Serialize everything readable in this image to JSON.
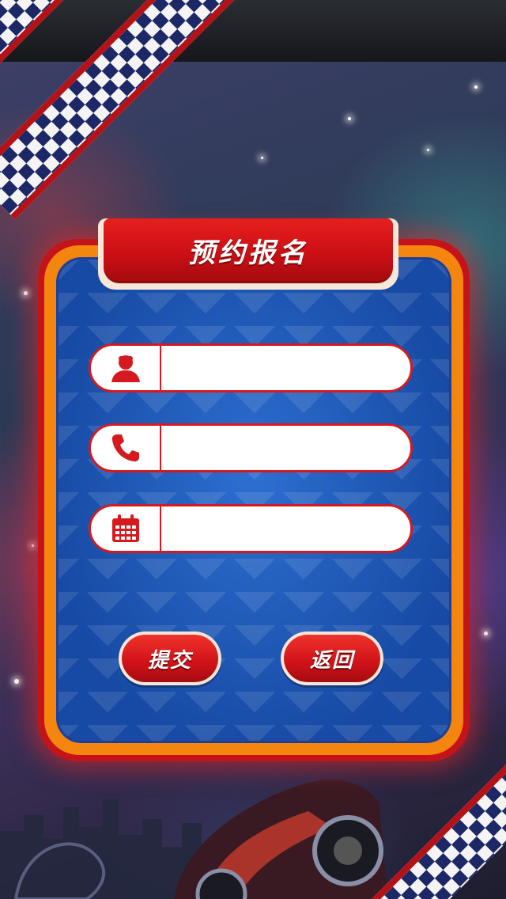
{
  "form": {
    "title": "预约报名",
    "fields": [
      {
        "icon": "user-icon",
        "value": "",
        "placeholder": ""
      },
      {
        "icon": "phone-icon",
        "value": "",
        "placeholder": ""
      },
      {
        "icon": "calendar-icon",
        "value": "",
        "placeholder": ""
      }
    ],
    "submit_label": "提交",
    "back_label": "返回"
  },
  "colors": {
    "primary_red": "#d51a1f",
    "panel_orange": "#f4860f",
    "panel_blue": "#1d56b8",
    "flag_navy": "#1c2766"
  }
}
